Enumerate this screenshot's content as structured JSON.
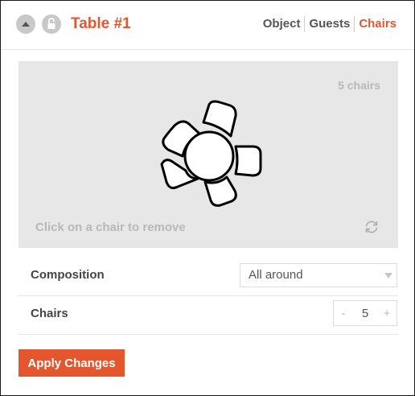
{
  "header": {
    "title": "Table #1",
    "icons": {
      "up": "chevron-up-icon",
      "lock": "lock-icon"
    },
    "tabs": [
      {
        "label": "Object",
        "active": false
      },
      {
        "label": "Guests",
        "active": false
      },
      {
        "label": "Chairs",
        "active": true
      }
    ]
  },
  "preview": {
    "chair_count_label": "5 chairs",
    "hint": "Click on a chair to remove",
    "reset_icon": "refresh-icon"
  },
  "composition": {
    "label": "Composition",
    "selected": "All around"
  },
  "chairs": {
    "label": "Chairs",
    "decrement": "-",
    "value": "5",
    "increment": "+"
  },
  "actions": {
    "apply_label": "Apply Changes"
  },
  "colors": {
    "accent": "#e4572e",
    "muted_text": "#b8b8b8",
    "preview_bg": "#e7e7e7",
    "icon_bg": "#c8c8c8"
  }
}
